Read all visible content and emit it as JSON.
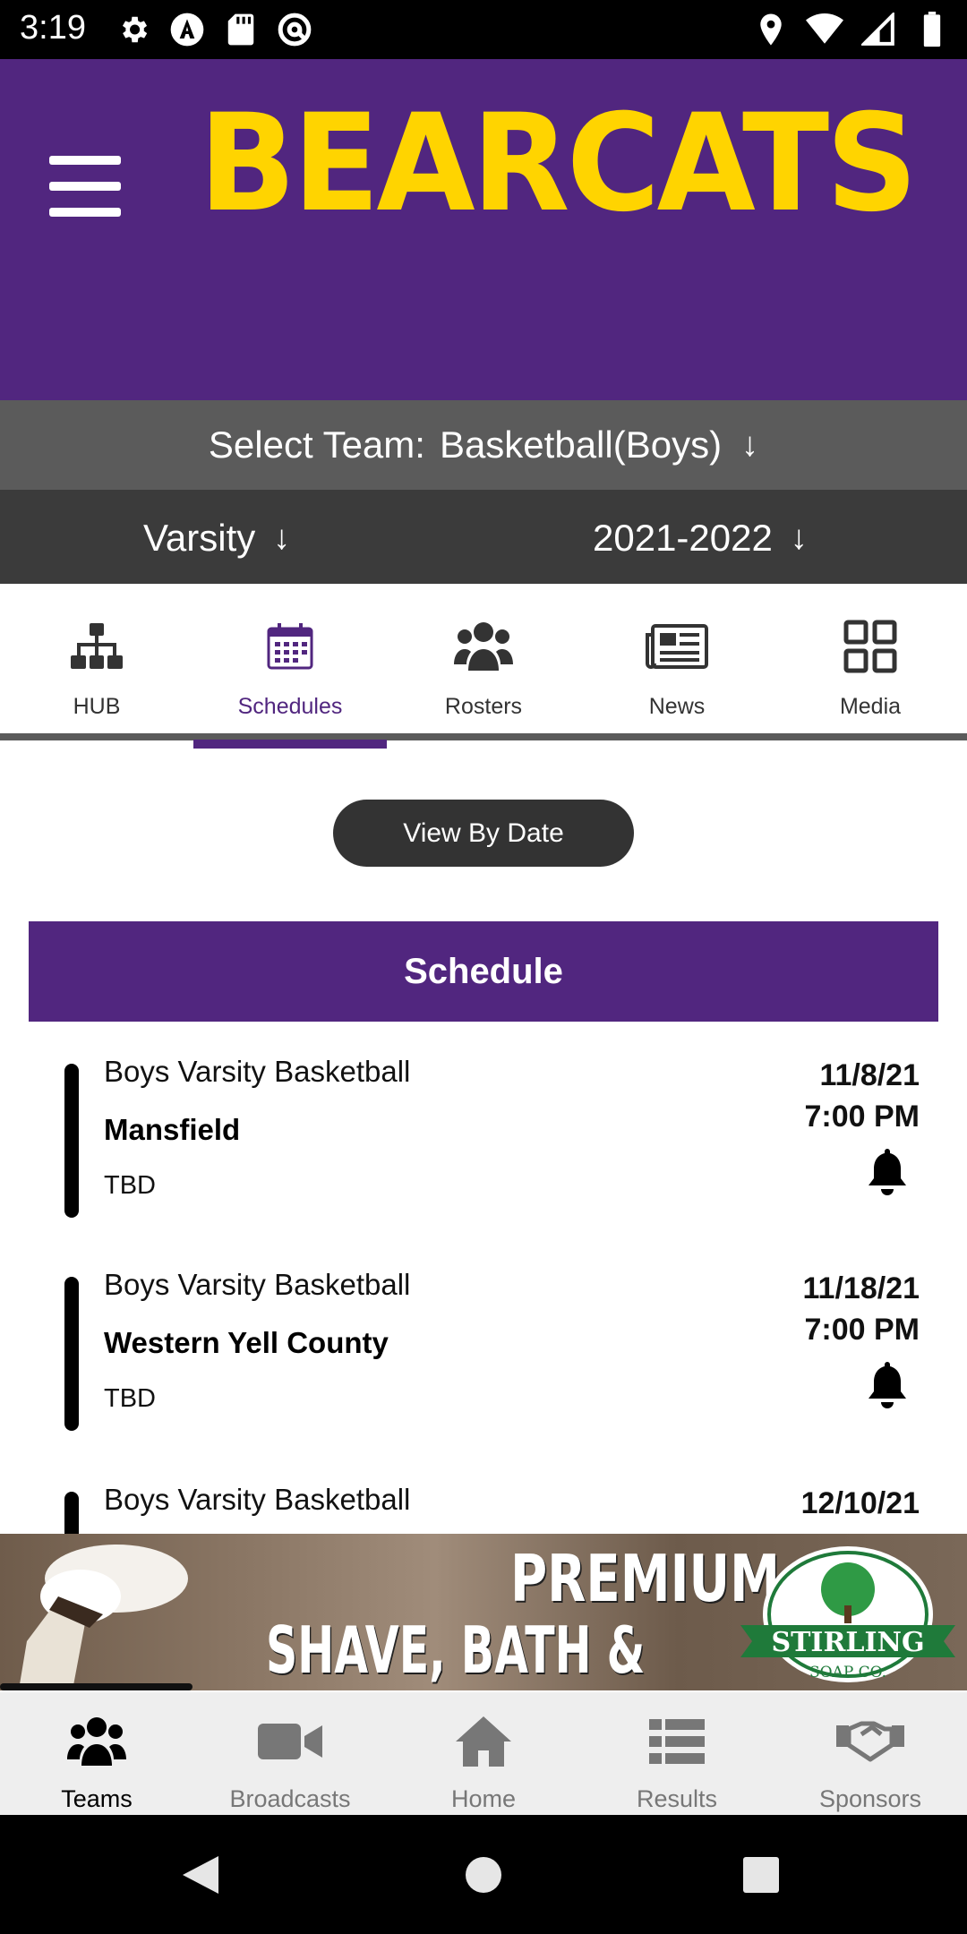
{
  "status_bar": {
    "time": "3:19",
    "left_icons": [
      "gear-icon",
      "a-circle-icon",
      "sd-card-icon",
      "at-circle-icon"
    ],
    "right_icons": [
      "location-icon",
      "wifi-icon",
      "signal-icon",
      "battery-icon"
    ]
  },
  "header": {
    "logo_text": "BEARCATS",
    "brand_color": "#51267f",
    "logo_color": "#ffd400"
  },
  "team_selector": {
    "label": "Select Team:",
    "value": "Basketball(Boys)",
    "arrow": "↓"
  },
  "filters": {
    "level": "Varsity",
    "season": "2021-2022",
    "arrow": "↓"
  },
  "tabs": [
    {
      "label": "HUB",
      "icon": "org-chart-icon"
    },
    {
      "label": "Schedules",
      "icon": "calendar-icon",
      "active": true
    },
    {
      "label": "Rosters",
      "icon": "group-icon"
    },
    {
      "label": "News",
      "icon": "newspaper-icon"
    },
    {
      "label": "Media",
      "icon": "grid-icon"
    }
  ],
  "view_by_date": "View By Date",
  "schedule": {
    "header": "Schedule",
    "games": [
      {
        "title": "Boys Varsity Basketball",
        "opponent": "Mansfield",
        "location": "TBD",
        "date": "11/8/21",
        "time": "7:00 PM"
      },
      {
        "title": "Boys Varsity Basketball",
        "opponent": "Western Yell County",
        "location": "TBD",
        "date": "11/18/21",
        "time": "7:00 PM"
      },
      {
        "title": "Boys Varsity Basketball",
        "date": "12/10/21"
      }
    ]
  },
  "ad": {
    "line1": "PREMIUM",
    "line2": "SHAVE, BATH & BODY",
    "brand": "STIRLING",
    "brand_sub": "SOAP CO."
  },
  "bottom_nav": [
    {
      "label": "Teams",
      "icon": "group-icon",
      "active": true
    },
    {
      "label": "Broadcasts",
      "icon": "video-camera-icon"
    },
    {
      "label": "Home",
      "icon": "home-icon"
    },
    {
      "label": "Results",
      "icon": "list-icon"
    },
    {
      "label": "Sponsors",
      "icon": "handshake-icon"
    }
  ]
}
